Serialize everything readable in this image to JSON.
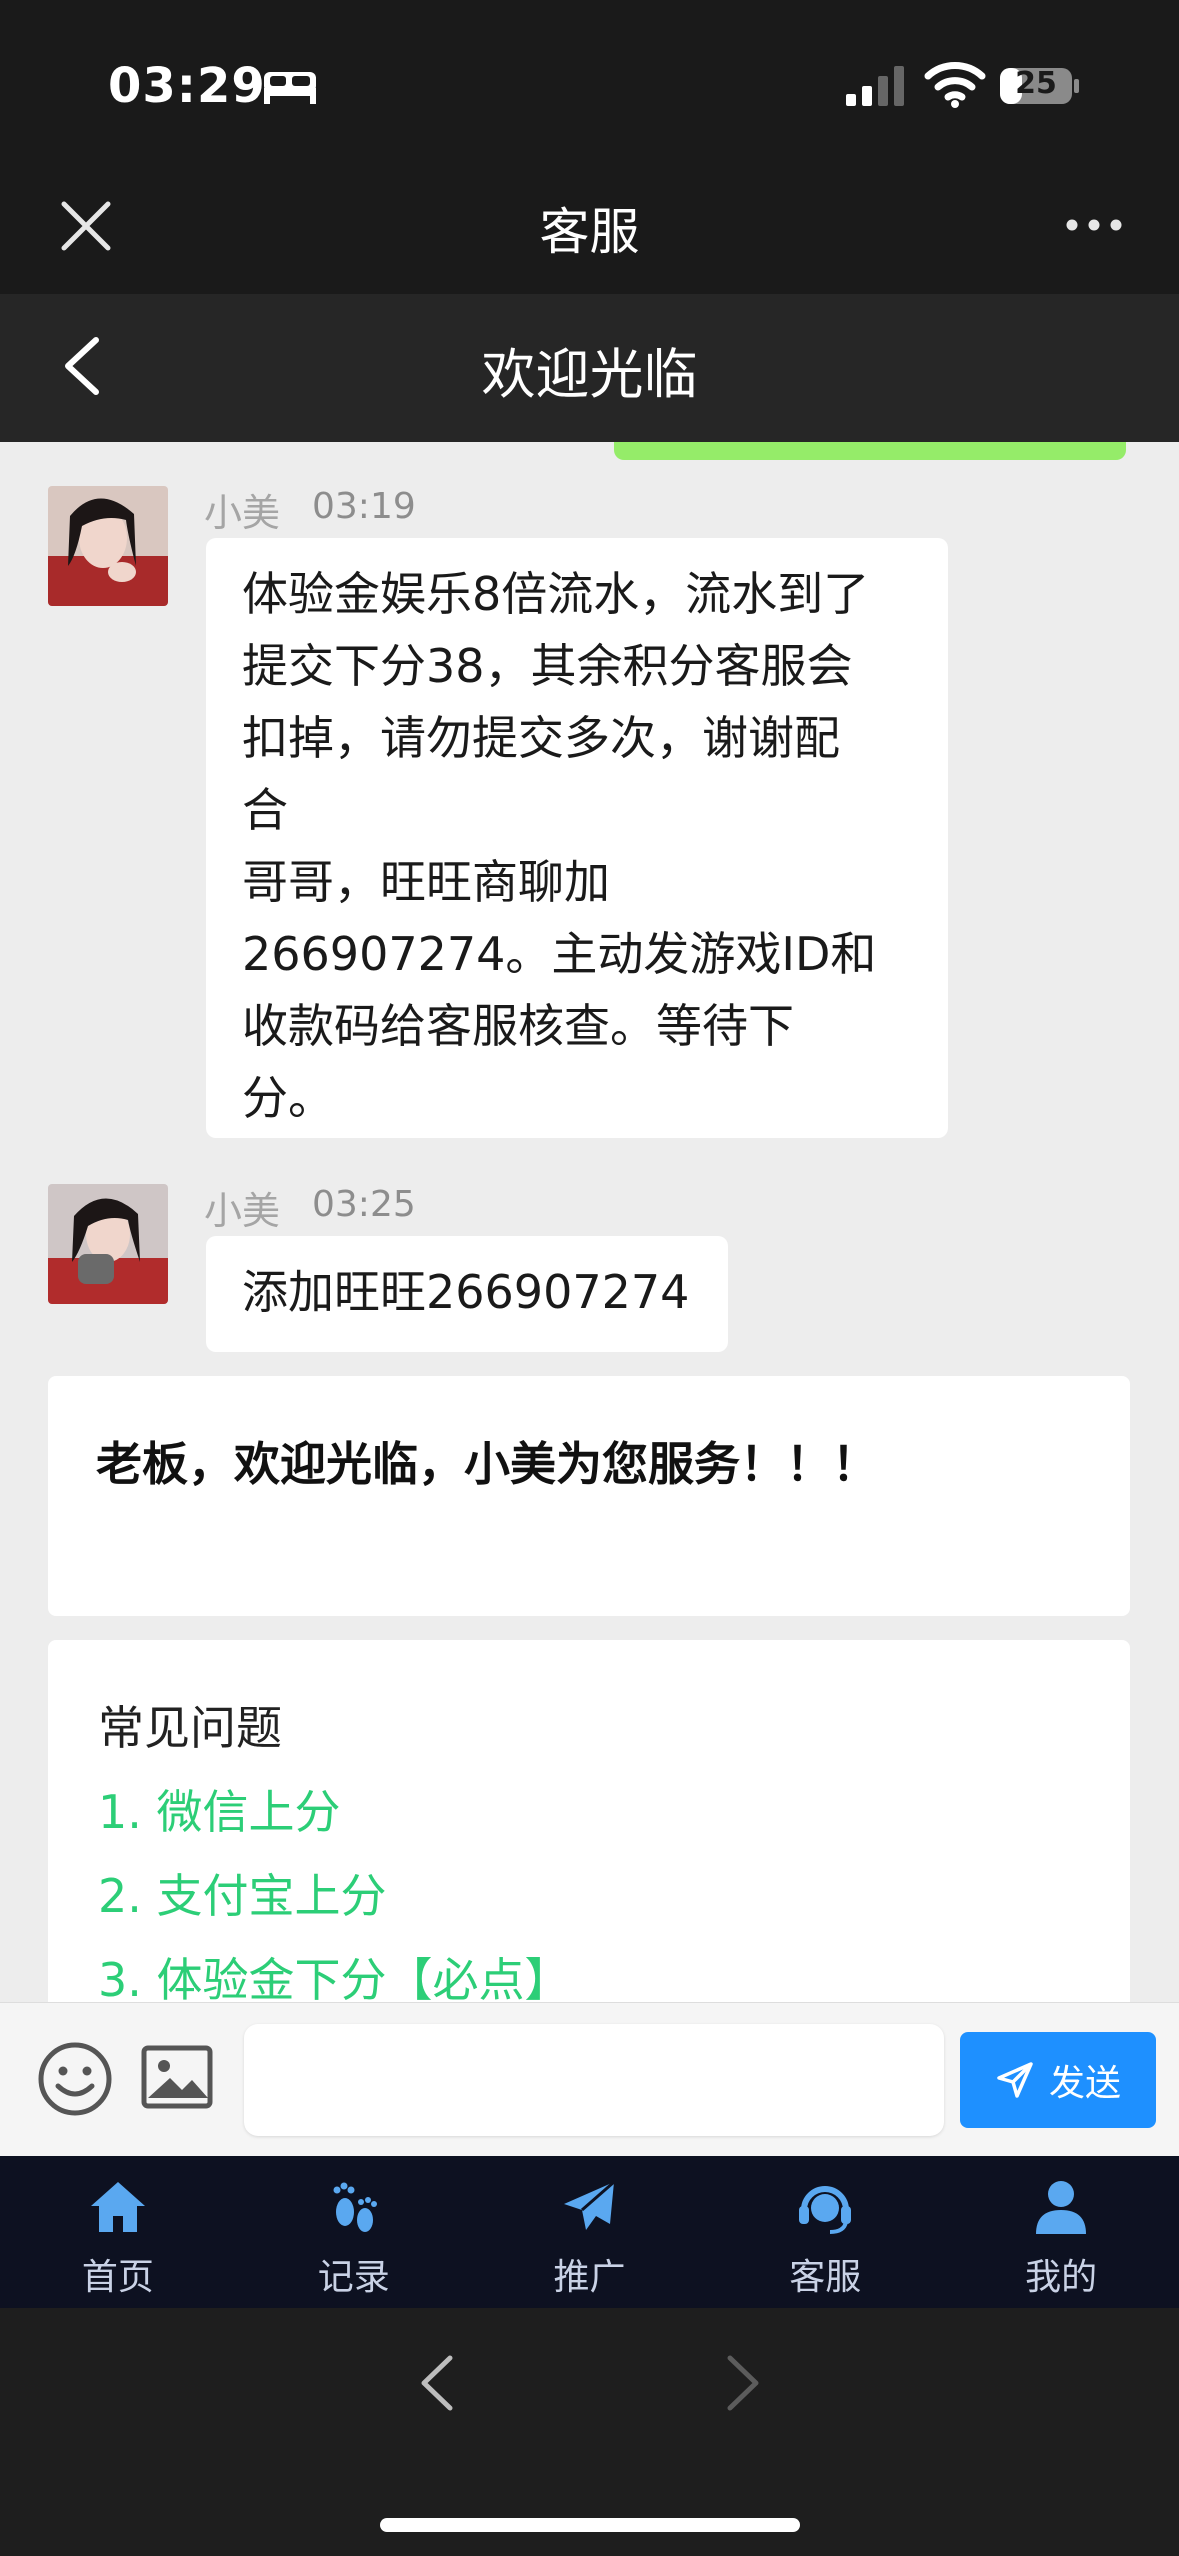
{
  "status": {
    "time": "03:29",
    "battery": "25"
  },
  "wechat": {
    "title": "客服"
  },
  "header": {
    "title": "欢迎光临"
  },
  "messages": [
    {
      "sender": "小美",
      "time": "03:19",
      "lines": [
        "体验金娱乐8倍流水，流水到了",
        "提交下分38，其余积分客服会",
        "扣掉，请勿提交多次，谢谢配",
        "合",
        "哥哥，旺旺商聊加",
        "266907274。主动发游戏ID和",
        "收款码给客服核查。等待下",
        "分。"
      ]
    },
    {
      "sender": "小美",
      "time": "03:25",
      "lines": [
        "添加旺旺266907274"
      ]
    }
  ],
  "welcome": {
    "text": "老板，欢迎光临，小美为您服务！！！"
  },
  "faq": {
    "title": "常见问题",
    "items": [
      "1. 微信上分",
      "2. 支付宝上分",
      "3. 体验金下分【必点】"
    ]
  },
  "input": {
    "placeholder": "",
    "send_label": "发送"
  },
  "tabs": [
    {
      "label": "首页",
      "icon": "home-icon"
    },
    {
      "label": "记录",
      "icon": "footprint-icon"
    },
    {
      "label": "推广",
      "icon": "paper-plane-icon"
    },
    {
      "label": "客服",
      "icon": "headset-icon"
    },
    {
      "label": "我的",
      "icon": "user-icon"
    }
  ],
  "colors": {
    "accent_green": "#2cce77",
    "send_blue": "#1e90ff",
    "tab_bg": "#0d1121"
  }
}
